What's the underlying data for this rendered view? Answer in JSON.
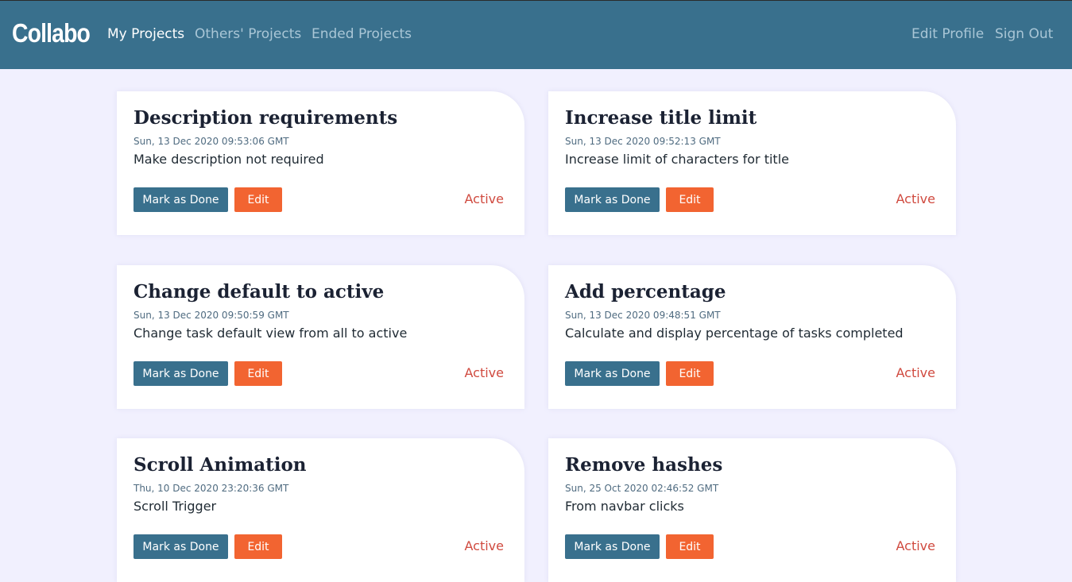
{
  "navbar": {
    "brand": "Collabo",
    "links": [
      {
        "label": "My Projects"
      },
      {
        "label": "Others' Projects"
      },
      {
        "label": "Ended Projects"
      }
    ],
    "right_links": [
      {
        "label": "Edit Profile"
      },
      {
        "label": "Sign Out"
      }
    ]
  },
  "cards": [
    {
      "title": "Description requirements",
      "date": "Sun, 13 Dec 2020 09:53:06 GMT",
      "description": "Make description not required",
      "done_label": "Mark as Done",
      "edit_label": "Edit",
      "status": "Active"
    },
    {
      "title": "Increase title limit",
      "date": "Sun, 13 Dec 2020 09:52:13 GMT",
      "description": "Increase limit of characters for title",
      "done_label": "Mark as Done",
      "edit_label": "Edit",
      "status": "Active"
    },
    {
      "title": "Change default to active",
      "date": "Sun, 13 Dec 2020 09:50:59 GMT",
      "description": "Change task default view from all to active",
      "done_label": "Mark as Done",
      "edit_label": "Edit",
      "status": "Active"
    },
    {
      "title": "Add percentage",
      "date": "Sun, 13 Dec 2020 09:48:51 GMT",
      "description": "Calculate and display percentage of tasks completed",
      "done_label": "Mark as Done",
      "edit_label": "Edit",
      "status": "Active"
    },
    {
      "title": "Scroll Animation",
      "date": "Thu, 10 Dec 2020 23:20:36 GMT",
      "description": "Scroll Trigger",
      "done_label": "Mark as Done",
      "edit_label": "Edit",
      "status": "Active"
    },
    {
      "title": "Remove hashes",
      "date": "Sun, 25 Oct 2020 02:46:52 GMT",
      "description": "From navbar clicks",
      "done_label": "Mark as Done",
      "edit_label": "Edit",
      "status": "Active"
    }
  ],
  "colors": {
    "navbar": "#39708d",
    "background": "#f1f0fe",
    "done_button": "#39708d",
    "edit_button": "#f26431",
    "status": "#d04a3f"
  }
}
